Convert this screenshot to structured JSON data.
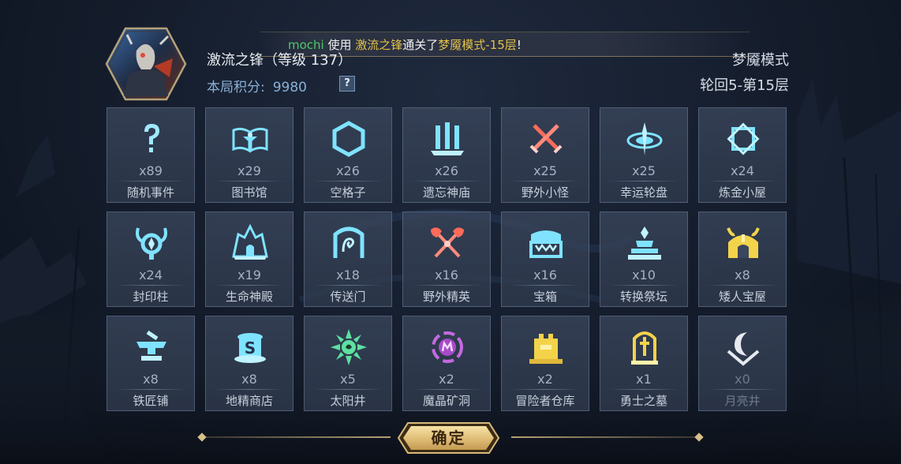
{
  "banner": {
    "user": "mochi",
    "text_use": " 使用 ",
    "hero": "激流之锋",
    "text_clear": "通关了",
    "mode_floor": "梦魇模式-15层",
    "suffix": "!"
  },
  "hero": {
    "name": "激流之锋（等级 137）"
  },
  "score": {
    "label": "本局积分:",
    "value": "9980",
    "help": "?"
  },
  "mode": {
    "title": "梦魇模式",
    "stage": "轮回5-第15层"
  },
  "tiles": [
    {
      "name": "随机事件",
      "count": "x89",
      "icon": "question-mark-icon"
    },
    {
      "name": "图书馆",
      "count": "x29",
      "icon": "book-icon"
    },
    {
      "name": "空格子",
      "count": "x26",
      "icon": "hexagon-icon"
    },
    {
      "name": "遗忘神庙",
      "count": "x26",
      "icon": "temple-icon"
    },
    {
      "name": "野外小怪",
      "count": "x25",
      "icon": "crossed-swords-icon"
    },
    {
      "name": "幸运轮盘",
      "count": "x25",
      "icon": "roulette-icon"
    },
    {
      "name": "炼金小屋",
      "count": "x24",
      "icon": "alchemy-icon"
    },
    {
      "name": "封印柱",
      "count": "x24",
      "icon": "seal-pillar-icon"
    },
    {
      "name": "生命神殿",
      "count": "x19",
      "icon": "life-shrine-icon"
    },
    {
      "name": "传送门",
      "count": "x18",
      "icon": "portal-icon"
    },
    {
      "name": "野外精英",
      "count": "x16",
      "icon": "crossed-axes-icon"
    },
    {
      "name": "宝箱",
      "count": "x16",
      "icon": "chest-icon"
    },
    {
      "name": "转换祭坛",
      "count": "x10",
      "icon": "altar-icon"
    },
    {
      "name": "矮人宝屋",
      "count": "x8",
      "icon": "dwarf-vault-icon"
    },
    {
      "name": "铁匠铺",
      "count": "x8",
      "icon": "anvil-icon"
    },
    {
      "name": "地精商店",
      "count": "x8",
      "icon": "goblin-shop-icon"
    },
    {
      "name": "太阳井",
      "count": "x5",
      "icon": "sun-well-icon"
    },
    {
      "name": "魔晶矿洞",
      "count": "x2",
      "icon": "crystal-mine-icon"
    },
    {
      "name": "冒险者仓库",
      "count": "x2",
      "icon": "warehouse-icon"
    },
    {
      "name": "勇士之墓",
      "count": "x1",
      "icon": "tomb-icon"
    },
    {
      "name": "月亮井",
      "count": "x0",
      "icon": "moon-well-icon"
    }
  ],
  "confirm_label": "确定",
  "colors": {
    "cyan_icon": "#7fe3ff",
    "red_icon": "#ff6a5a",
    "gold_icon": "#f3d34a",
    "green_icon": "#5de0a0",
    "purple_icon": "#c46ae0",
    "user_green": "#4ec86a",
    "gold_text": "#e3c14a"
  }
}
